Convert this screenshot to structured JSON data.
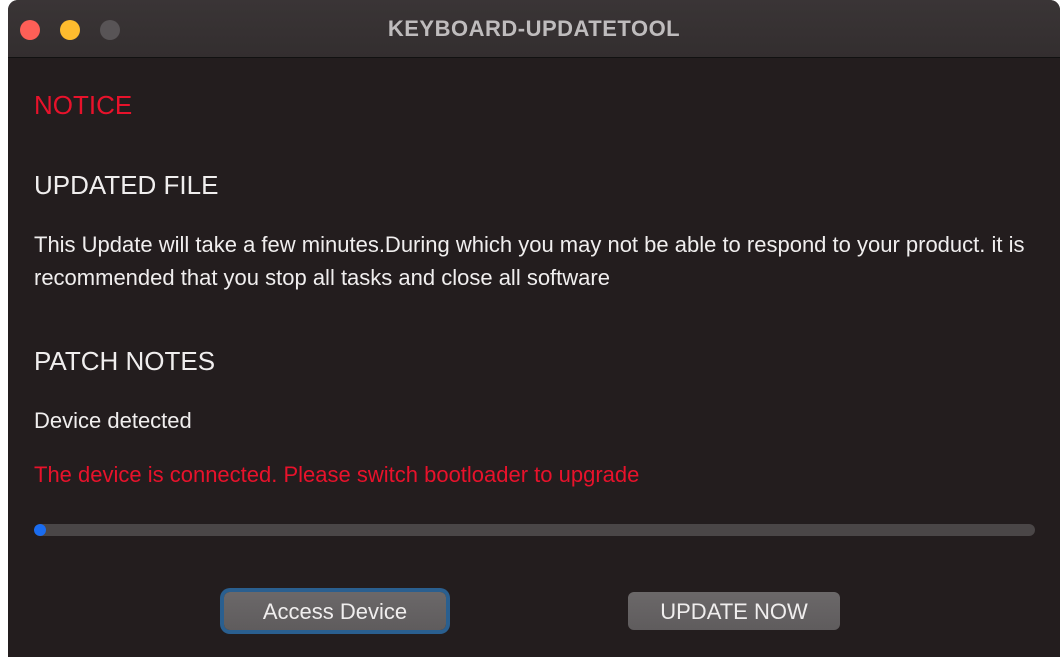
{
  "window": {
    "title": "KEYBOARD-UPDATETOOL"
  },
  "notice": {
    "label": "NOTICE"
  },
  "updated_file": {
    "heading": "UPDATED FILE",
    "description": "This Update will take a few minutes.During which you may not be able to respond to your product. it is recommended that you stop all tasks and close all software"
  },
  "patch_notes": {
    "heading": "PATCH NOTES",
    "device_status": "Device detected",
    "connection_message": "The device is connected. Please switch bootloader to upgrade"
  },
  "progress": {
    "fraction": 0.01
  },
  "buttons": {
    "access_device": "Access Device",
    "update_now": "UPDATE NOW"
  },
  "colors": {
    "background": "#231d1e",
    "alert_red": "#e8122b",
    "progress_blue": "#1a6cf0",
    "focus_ring": "#2a5f8f"
  }
}
